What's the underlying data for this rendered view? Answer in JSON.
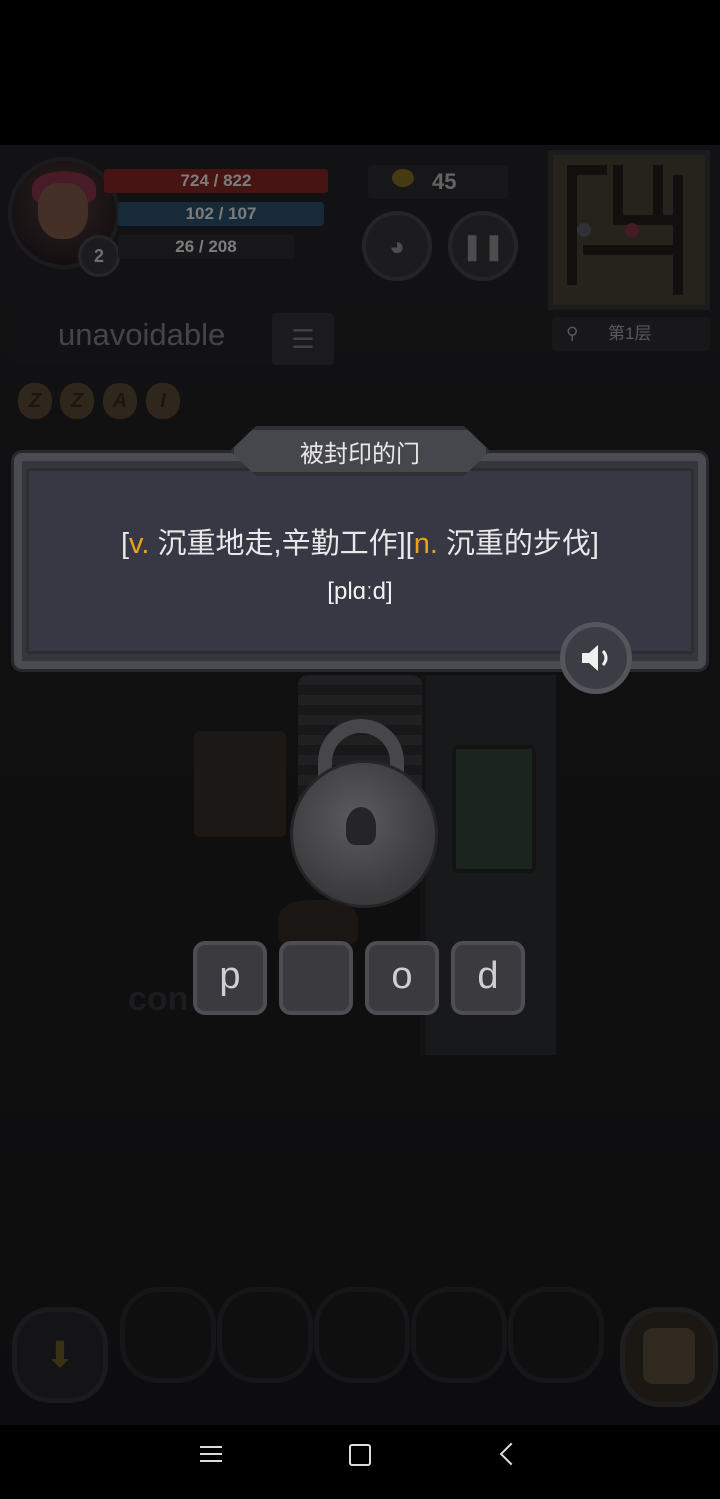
{
  "hud": {
    "level": "2",
    "hp": "724 / 822",
    "mp": "102 / 107",
    "xp": "26 / 208",
    "coins": "45",
    "floor": "第1层"
  },
  "word_tab": {
    "current_word": "unavoidable",
    "runes": [
      "Z",
      "Z",
      "A",
      "I"
    ]
  },
  "scene": {
    "background_word": "con"
  },
  "popup": {
    "title": "被封印的门",
    "meaning_parts": [
      {
        "text": "[",
        "kind": "bracket"
      },
      {
        "text": "v.",
        "kind": "pos"
      },
      {
        "text": " 沉重地走,辛勤工作]",
        "kind": "def"
      },
      {
        "text": "[",
        "kind": "bracket"
      },
      {
        "text": "n.",
        "kind": "pos"
      },
      {
        "text": " 沉重的步伐]",
        "kind": "def"
      }
    ],
    "phonetic": "[plɑːd]"
  },
  "letters": [
    "p",
    "",
    "o",
    "d"
  ],
  "icons": {
    "pet": "cat-face-icon",
    "pause": "pause-icon",
    "menu": "list-icon",
    "search": "search-icon",
    "sound": "speaker-icon",
    "down": "arrow-down-icon",
    "bag": "backpack-icon"
  },
  "colors": {
    "pos_accent": "#e7a21f",
    "hp_bar": "#6e1f1f",
    "mp_bar": "#23415a"
  }
}
